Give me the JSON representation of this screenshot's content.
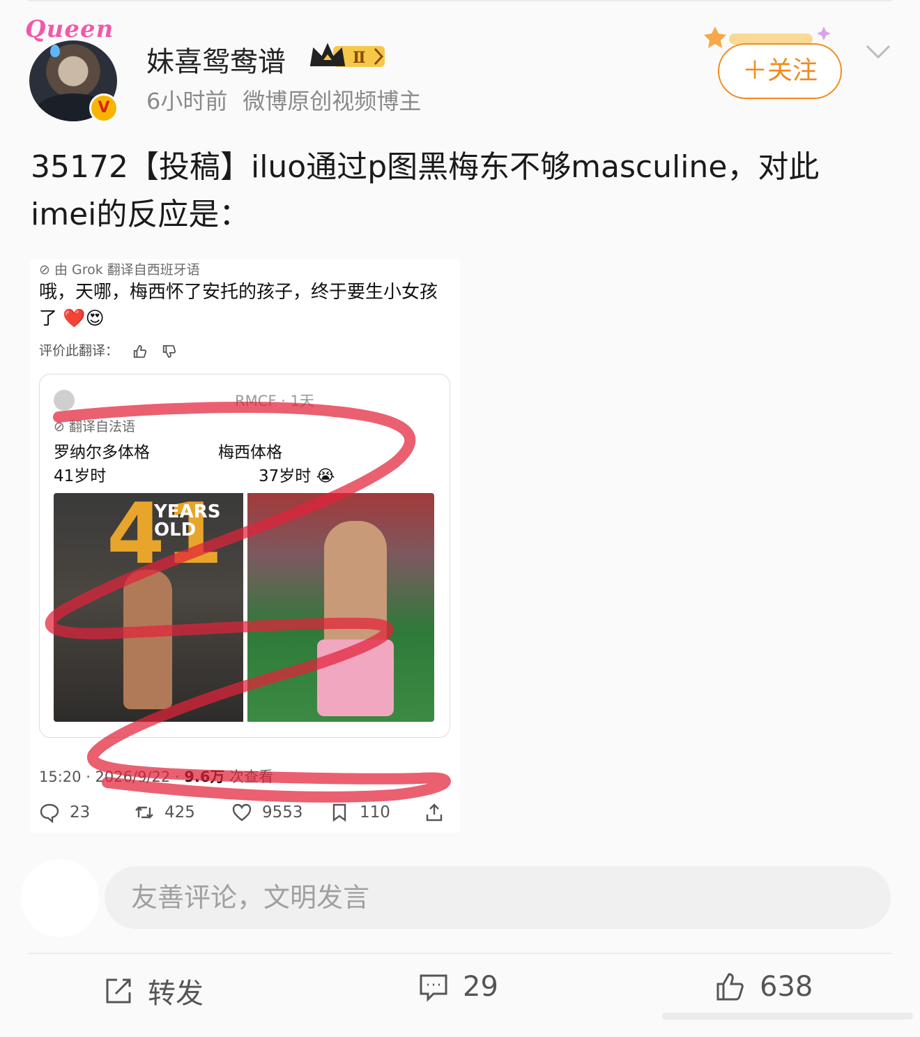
{
  "post": {
    "author": {
      "name": "妹喜鸳鸯谱",
      "level_badge": "Ⅱ",
      "avatar_frame_text": "Queen",
      "verified_mark": "V",
      "time": "6小时前",
      "description": "微博原创视频博主"
    },
    "follow_label": "＋关注",
    "text_line1": "35172【投稿】iluo通过p图黑梅东不够masculine，对此",
    "text_line2": "imei的反应是："
  },
  "embedded": {
    "translation_note": "由 Grok 翻译自西班牙语",
    "tweet_text": "哦，天哪，梅西怀了安托的孩子，终于要生小女孩了 ❤️😍",
    "rate_label": "评价此翻译：",
    "quote": {
      "handle": "RMCF · 1天",
      "translation_note": "翻译自法语",
      "left_line1": "罗纳尔多体格",
      "left_line2": "41岁时",
      "right_line1": "梅西体格",
      "right_line2": "37岁时 😭",
      "img1_big": "41",
      "img1_text": "YEARS OLD"
    },
    "timestamp": "15:20 · 2026/9/22 · ",
    "views": "9.6万",
    "views_suffix": " 次查看",
    "stats": {
      "replies": "23",
      "retweets": "425",
      "likes": "9553",
      "bookmarks": "110"
    }
  },
  "comment_placeholder": "友善评论，文明发言",
  "bottom_bar": {
    "repost_label": "转发",
    "comments_count": "29",
    "likes_count": "638"
  },
  "colors": {
    "accent_orange": "#f18a1b",
    "scribble_red": "#e2223a",
    "text_gray": "#8a8a8a"
  }
}
